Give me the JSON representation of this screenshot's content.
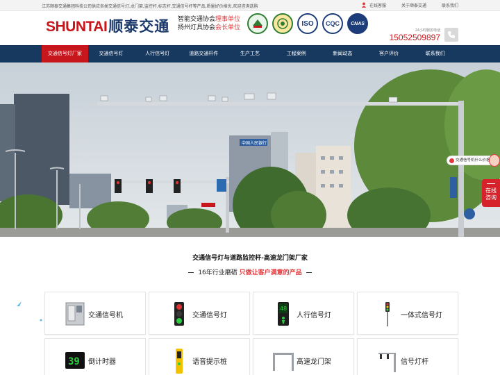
{
  "topbar": {
    "intro": "江苏顺泰交通集团科技公司供应各类交通信号灯,龙门架,监控杆,标志杆,交通信号杆等产品,质量好价格优,欢迎咨询选购",
    "links": [
      "在线客服",
      "关于顺泰交通",
      "联系我们"
    ]
  },
  "header": {
    "logo_en": "SHUNTAI",
    "logo_cn": "顺泰交通",
    "slogan_line1_a": "智能交通协会",
    "slogan_line1_b": "理事单位",
    "slogan_line2_a": "扬州灯具协会",
    "slogan_line2_b": "会长单位",
    "certs": [
      "",
      "",
      "ISO",
      "CQC",
      "CNAS"
    ],
    "hotline_label": "24小时服务电话",
    "hotline_number": "15052509897"
  },
  "nav": {
    "items": [
      "交通信号灯厂家",
      "交通信号灯",
      "人行信号灯",
      "道路交通杆件",
      "生产工艺",
      "工程案例",
      "新闻动态",
      "客户评价",
      "联系我们"
    ],
    "active_index": 0
  },
  "banner": {
    "sign_text": "中国人民银行"
  },
  "float": {
    "bubble": "交通信号机什么价格？",
    "consult_line1": "在线",
    "consult_line2": "咨询"
  },
  "section": {
    "title": "交通信号灯与道路监控杆-高速龙门架厂家",
    "sub_plain": "16年行业磨砺",
    "sub_em": "只做让客户满意的产品"
  },
  "products": [
    {
      "name": "交通信号机",
      "icon": "signal-controller-cabinet-icon"
    },
    {
      "name": "交通信号灯",
      "icon": "traffic-light-icon"
    },
    {
      "name": "人行信号灯",
      "icon": "pedestrian-light-icon"
    },
    {
      "name": "一体式信号灯",
      "icon": "integrated-signal-light-icon"
    },
    {
      "name": "倒计时器",
      "icon": "countdown-timer-icon",
      "display": "39"
    },
    {
      "name": "语音提示桩",
      "icon": "voice-prompt-post-icon"
    },
    {
      "name": "高速龙门架",
      "icon": "gantry-frame-icon"
    },
    {
      "name": "信号灯杆",
      "icon": "signal-pole-icon"
    }
  ],
  "colors": {
    "brand_red": "#c8161d",
    "nav_blue": "#17395f",
    "accent_red": "#e4393c"
  }
}
